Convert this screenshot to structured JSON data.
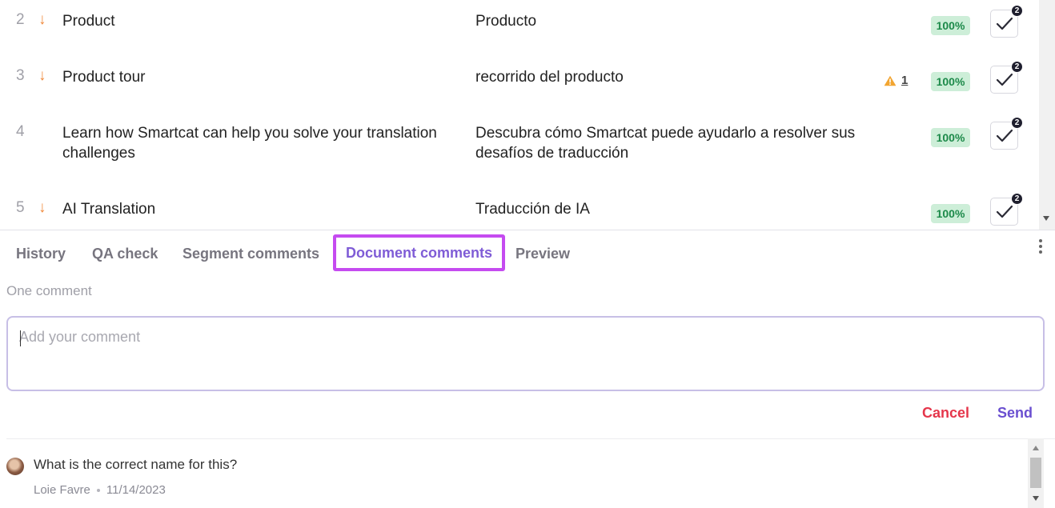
{
  "segments": [
    {
      "number": "2",
      "arrow": "↓",
      "source": "Product",
      "target": "Producto",
      "warnings": "",
      "match": "100%",
      "badge": "2"
    },
    {
      "number": "3",
      "arrow": "↓",
      "source": "Product tour",
      "target": "recorrido del producto",
      "warnings": "1",
      "match": "100%",
      "badge": "2"
    },
    {
      "number": "4",
      "arrow": "",
      "source": "Learn how Smartcat can help you solve your translation challenges",
      "target": "Descubra cómo Smartcat puede ayudarlo a resolver sus desafíos de traducción",
      "warnings": "",
      "match": "100%",
      "badge": "2"
    },
    {
      "number": "5",
      "arrow": "↓",
      "source": "AI Translation",
      "target": "Traducción de IA",
      "warnings": "",
      "match": "100%",
      "badge": "2"
    }
  ],
  "tabs": [
    {
      "label": "History"
    },
    {
      "label": "QA check"
    },
    {
      "label": "Segment comments"
    },
    {
      "label": "Document comments"
    },
    {
      "label": "Preview"
    }
  ],
  "active_tab": "Document comments",
  "comments_panel": {
    "count_label": "One comment",
    "input_placeholder": "Add your comment",
    "cancel_label": "Cancel",
    "send_label": "Send"
  },
  "comments": [
    {
      "text": "What is the correct name for this?",
      "author": "Loie Favre",
      "date": "11/14/2023"
    }
  ],
  "colors": {
    "accent": "#7f5cd6",
    "highlight_border": "#c54bf0",
    "match_bg": "#cdeed8",
    "match_text": "#1d8a4a",
    "cancel": "#e5364b",
    "send": "#6a4fd0",
    "arrow": "#f08a3c",
    "warning": "#f2a531"
  },
  "icons": {
    "arrow": "arrow-down-icon",
    "warning": "warning-triangle-icon",
    "confirm": "checkmark-icon",
    "more": "more-vertical-icon"
  }
}
